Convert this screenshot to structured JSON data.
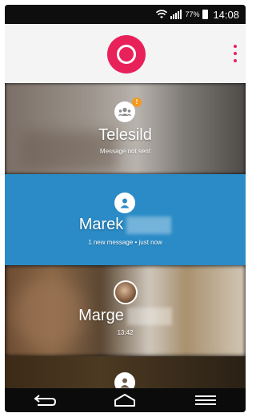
{
  "status_bar": {
    "battery_percent": "77%",
    "time": "14:08",
    "icons": [
      "wifi-icon",
      "signal-icon",
      "battery-icon"
    ]
  },
  "header": {
    "brand_icon": "app-logo-icon",
    "menu_icon": "overflow-menu-icon",
    "accent_color": "#e8215a"
  },
  "conversations": [
    {
      "name": "Telesild",
      "status": "Message not sent",
      "badge": "!",
      "icon": "group-icon"
    },
    {
      "name": "Marek",
      "status": "1 new message • just now",
      "icon": "person-icon",
      "highlight_color": "#2a8bc6"
    },
    {
      "name": "Marge",
      "status": "13:42",
      "icon": "photo-avatar"
    },
    {
      "name": "",
      "status": "",
      "icon": "person-icon"
    }
  ],
  "nav_bar": {
    "icons": [
      "back-icon",
      "home-icon",
      "menu-icon"
    ]
  }
}
